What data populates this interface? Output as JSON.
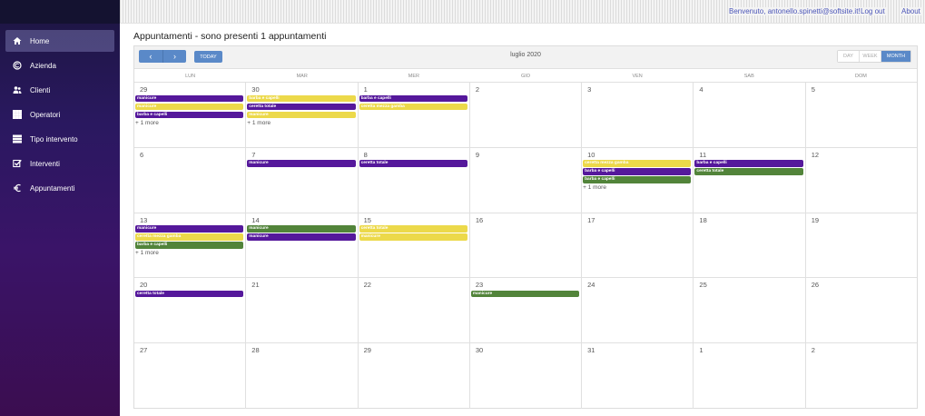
{
  "sidebar": {
    "items": [
      {
        "label": "Home",
        "icon": "home-icon",
        "active": true
      },
      {
        "label": "Azienda",
        "icon": "copyright-icon",
        "active": false
      },
      {
        "label": "Clienti",
        "icon": "users-icon",
        "active": false
      },
      {
        "label": "Operatori",
        "icon": "grid-icon",
        "active": false
      },
      {
        "label": "Tipo intervento",
        "icon": "list-icon",
        "active": false
      },
      {
        "label": "Interventi",
        "icon": "checkbox-icon",
        "active": false
      },
      {
        "label": "Appuntamenti",
        "icon": "euro-icon",
        "active": false
      }
    ]
  },
  "topbar": {
    "welcome": "Benvenuto, antonello.spinetti@softsite.it!",
    "logout": "Log out",
    "about": "About"
  },
  "page": {
    "title": "Appuntamenti - sono presenti 1 appuntamenti"
  },
  "calendar": {
    "title": "luglio 2020",
    "today_label": "TODAY",
    "prev_icon": "‹",
    "next_icon": "›",
    "views": [
      "DAY",
      "WEEK",
      "MONTH"
    ],
    "active_view": "MONTH",
    "days_of_week": [
      "LUN",
      "MAR",
      "MER",
      "GIO",
      "VEN",
      "SAB",
      "DOM"
    ],
    "event_colors": {
      "purple": "#55189b",
      "yellow": "#ecd94a",
      "green": "#52843a"
    },
    "weeks": [
      [
        {
          "num": "29",
          "events": [
            {
              "t": "manicure",
              "c": "purple"
            },
            {
              "t": "manicure",
              "c": "yellow"
            },
            {
              "t": "barba e capelli",
              "c": "purple"
            }
          ],
          "more": "+ 1 more"
        },
        {
          "num": "30",
          "events": [
            {
              "t": "barba e capelli",
              "c": "yellow"
            },
            {
              "t": "ceretta totale",
              "c": "purple"
            },
            {
              "t": "manicure",
              "c": "yellow"
            }
          ],
          "more": "+ 1 more"
        },
        {
          "num": "1",
          "events": [
            {
              "t": "barba e capelli",
              "c": "purple"
            },
            {
              "t": "ceretta mezza gamba",
              "c": "yellow"
            }
          ]
        },
        {
          "num": "2",
          "events": []
        },
        {
          "num": "3",
          "events": []
        },
        {
          "num": "4",
          "events": []
        },
        {
          "num": "5",
          "events": []
        }
      ],
      [
        {
          "num": "6",
          "events": []
        },
        {
          "num": "7",
          "events": [
            {
              "t": "manicure",
              "c": "purple"
            }
          ]
        },
        {
          "num": "8",
          "events": [
            {
              "t": "ceretta totale",
              "c": "purple"
            }
          ]
        },
        {
          "num": "9",
          "events": []
        },
        {
          "num": "10",
          "events": [
            {
              "t": "ceretta mezza gamba",
              "c": "yellow"
            },
            {
              "t": "barba e capelli",
              "c": "purple"
            },
            {
              "t": "barba e capelli",
              "c": "green"
            }
          ],
          "more": "+ 1 more"
        },
        {
          "num": "11",
          "events": [
            {
              "t": "barba e capelli",
              "c": "purple"
            },
            {
              "t": "ceretta totale",
              "c": "green"
            }
          ]
        },
        {
          "num": "12",
          "events": []
        }
      ],
      [
        {
          "num": "13",
          "events": [
            {
              "t": "manicure",
              "c": "purple"
            },
            {
              "t": "ceretta mezza gamba",
              "c": "yellow"
            },
            {
              "t": "barba e capelli",
              "c": "green"
            }
          ],
          "more": "+ 1 more"
        },
        {
          "num": "14",
          "events": [
            {
              "t": "manicure",
              "c": "green"
            },
            {
              "t": "manicure",
              "c": "purple"
            }
          ]
        },
        {
          "num": "15",
          "events": [
            {
              "t": "ceretta totale",
              "c": "yellow"
            },
            {
              "t": "manicure",
              "c": "yellow"
            }
          ]
        },
        {
          "num": "16",
          "events": []
        },
        {
          "num": "17",
          "events": []
        },
        {
          "num": "18",
          "events": []
        },
        {
          "num": "19",
          "events": []
        }
      ],
      [
        {
          "num": "20",
          "events": [
            {
              "t": "ceretta totale",
              "c": "purple"
            }
          ]
        },
        {
          "num": "21",
          "events": []
        },
        {
          "num": "22",
          "events": []
        },
        {
          "num": "23",
          "events": [
            {
              "t": "manicure",
              "c": "green"
            }
          ]
        },
        {
          "num": "24",
          "events": []
        },
        {
          "num": "25",
          "events": []
        },
        {
          "num": "26",
          "events": []
        }
      ],
      [
        {
          "num": "27",
          "events": []
        },
        {
          "num": "28",
          "events": []
        },
        {
          "num": "29",
          "events": []
        },
        {
          "num": "30",
          "events": []
        },
        {
          "num": "31",
          "events": []
        },
        {
          "num": "1",
          "events": []
        },
        {
          "num": "2",
          "events": []
        }
      ]
    ]
  }
}
